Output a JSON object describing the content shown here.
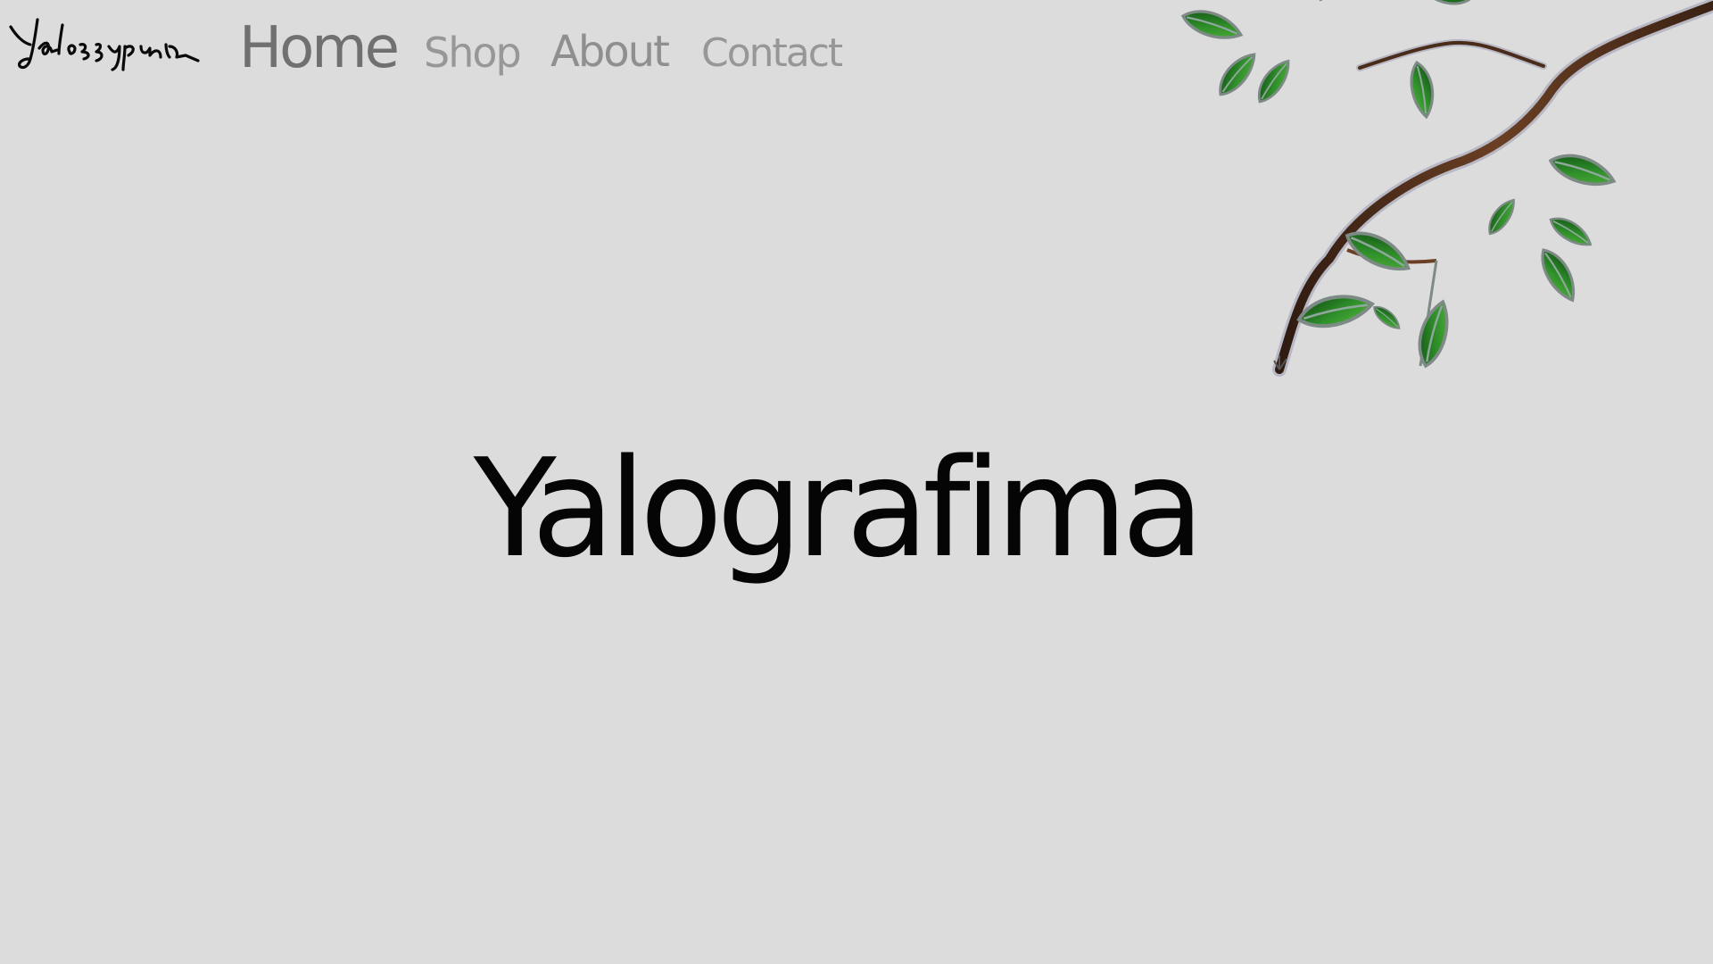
{
  "site": {
    "logo_text": "Yalografima"
  },
  "nav": {
    "items": [
      {
        "label": "Home"
      },
      {
        "label": "Shop"
      },
      {
        "label": "About"
      },
      {
        "label": "Contact"
      }
    ]
  },
  "hero": {
    "title": "Yalografima"
  },
  "decoration": {
    "branch": "leafy-branch-illustration",
    "leaf_color": "#2f8f2a",
    "leaf_dark": "#0f4d12",
    "branch_color": "#5a3520"
  }
}
